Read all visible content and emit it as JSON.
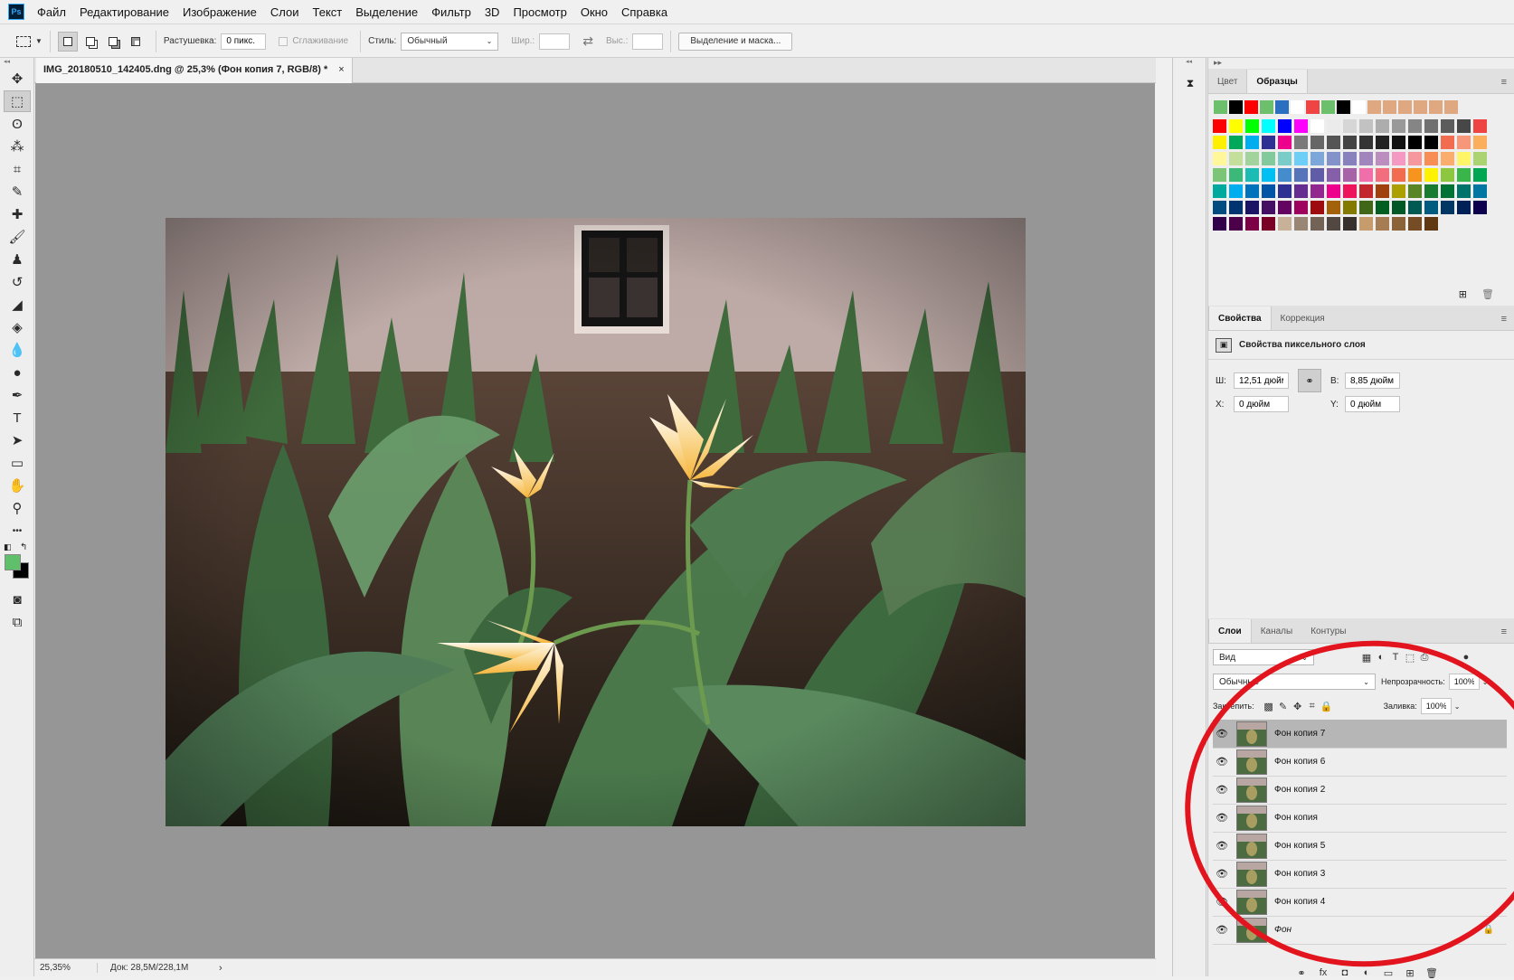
{
  "app": {
    "logo": "Ps",
    "menu": [
      "Файл",
      "Редактирование",
      "Изображение",
      "Слои",
      "Текст",
      "Выделение",
      "Фильтр",
      "3D",
      "Просмотр",
      "Окно",
      "Справка"
    ]
  },
  "options": {
    "feather_label": "Растушевка:",
    "feather_value": "0 пикс.",
    "antialias_label": "Сглаживание",
    "style_label": "Стиль:",
    "style_value": "Обычный",
    "width_label": "Шир.:",
    "height_label": "Выс.:",
    "select_mask_button": "Выделение и маска..."
  },
  "document": {
    "tab_title": "IMG_20180510_142405.dng @ 25,3% (Фон копия 7, RGB/8) *",
    "close": "×",
    "zoom": "25,35%",
    "doc_size": "Док: 28,5M/228,1M",
    "status_arrow": "›"
  },
  "toolbar": {
    "tools": [
      {
        "name": "move-tool",
        "glyph": "✥"
      },
      {
        "name": "marquee-tool",
        "glyph": "⬚",
        "active": true
      },
      {
        "name": "lasso-tool",
        "glyph": "ʘ"
      },
      {
        "name": "magic-wand-tool",
        "glyph": "⁂"
      },
      {
        "name": "crop-tool",
        "glyph": "⌗"
      },
      {
        "name": "eyedropper-tool",
        "glyph": "✎"
      },
      {
        "name": "healing-tool",
        "glyph": "✚"
      },
      {
        "name": "brush-tool",
        "glyph": "🖌"
      },
      {
        "name": "stamp-tool",
        "glyph": "♟"
      },
      {
        "name": "history-brush-tool",
        "glyph": "↺"
      },
      {
        "name": "eraser-tool",
        "glyph": "◢"
      },
      {
        "name": "paint-bucket-tool",
        "glyph": "◈"
      },
      {
        "name": "blur-tool",
        "glyph": "💧"
      },
      {
        "name": "dodge-tool",
        "glyph": "●"
      },
      {
        "name": "pen-tool",
        "glyph": "✒"
      },
      {
        "name": "type-tool",
        "glyph": "T"
      },
      {
        "name": "path-selection-tool",
        "glyph": "➤"
      },
      {
        "name": "rectangle-tool",
        "glyph": "▭"
      },
      {
        "name": "hand-tool",
        "glyph": "✋"
      },
      {
        "name": "zoom-tool",
        "glyph": "⚲"
      },
      {
        "name": "more-tools",
        "glyph": "•••"
      }
    ],
    "foreground_color": "#5fbf6b",
    "background_color": "#000000"
  },
  "swatches_panel": {
    "tabs": [
      "Цвет",
      "Образцы"
    ],
    "active_tab": 1,
    "recent": [
      "#6cc06c",
      "#000000",
      "#ff0000",
      "#6cc06c",
      "#2a6fc0",
      "#ffffff",
      "#ef4444",
      "#6cc06c",
      "#000000",
      "#ffffff",
      "#e0a880",
      "#e0a880",
      "#e0a880",
      "#e0a880",
      "#e0a880",
      "#e0a880"
    ],
    "grid": [
      "#ff0000",
      "#ffff00",
      "#00ff00",
      "#00ffff",
      "#0000ff",
      "#ff00ff",
      "#ffffff",
      "#ebebeb",
      "#d6d6d6",
      "#c2c2c2",
      "#adadad",
      "#999999",
      "#858585",
      "#707070",
      "#5c5c5c",
      "#474747",
      "#ef4444",
      "#ffef00",
      "#00a859",
      "#00aeef",
      "#2e3192",
      "#ec008c",
      "#7a7a7a",
      "#666666",
      "#555555",
      "#444444",
      "#333333",
      "#222222",
      "#111111",
      "#000000",
      "#000000",
      "#f26c4f",
      "#f7977a",
      "#fbaf5d",
      "#fff799",
      "#c4df9b",
      "#a3d39c",
      "#82ca9c",
      "#7accc8",
      "#6dcff6",
      "#7da7d8",
      "#8393ca",
      "#8781bd",
      "#a186be",
      "#bc8dbf",
      "#f49ac2",
      "#f5989d",
      "#f68e56",
      "#fbad6d",
      "#fff568",
      "#acd372",
      "#7cc576",
      "#3cb878",
      "#1cbbb4",
      "#00bff3",
      "#448ccb",
      "#5574b9",
      "#605ca8",
      "#855fa8",
      "#a763a8",
      "#f06eaa",
      "#f26d7d",
      "#f26c4f",
      "#f7941d",
      "#fff200",
      "#8dc73f",
      "#39b54a",
      "#00a651",
      "#00a99d",
      "#00aeef",
      "#0072bc",
      "#0054a6",
      "#2e3192",
      "#662d91",
      "#92278f",
      "#ec008c",
      "#ed145b",
      "#c1272d",
      "#a0410d",
      "#aba000",
      "#598527",
      "#197b30",
      "#007236",
      "#00746b",
      "#0076a3",
      "#004b80",
      "#003471",
      "#1b1464",
      "#440e62",
      "#630460",
      "#9e005d",
      "#9e0b0f",
      "#a36209",
      "#827b00",
      "#406618",
      "#005e20",
      "#005826",
      "#005952",
      "#005b7f",
      "#003663",
      "#002157",
      "#0d004c",
      "#32004b",
      "#4b0049",
      "#7b0046",
      "#7a0026",
      "#c7b299",
      "#998675",
      "#736357",
      "#534741",
      "#37302d",
      "#c69c6d",
      "#a67c52",
      "#8c6239",
      "#754c24",
      "#603913"
    ]
  },
  "properties_panel": {
    "tabs": [
      "Свойства",
      "Коррекция"
    ],
    "active_tab": 0,
    "title": "Свойства пиксельного слоя",
    "w_label": "Ш:",
    "w_value": "12,51 дюйм",
    "h_label": "В:",
    "h_value": "8,85 дюйм",
    "x_label": "X:",
    "x_value": "0 дюйм",
    "y_label": "Y:",
    "y_value": "0 дюйм"
  },
  "layers_panel": {
    "tabs": [
      "Слои",
      "Каналы",
      "Контуры"
    ],
    "active_tab": 0,
    "filter_placeholder": "Вид",
    "blend_mode": "Обычные",
    "opacity_label": "Непрозрачность:",
    "opacity_value": "100%",
    "lock_label": "Закрепить:",
    "fill_label": "Заливка:",
    "fill_value": "100%",
    "layers": [
      {
        "name": "Фон копия 7",
        "selected": true
      },
      {
        "name": "Фон копия 6"
      },
      {
        "name": "Фон копия 2"
      },
      {
        "name": "Фон копия"
      },
      {
        "name": "Фон копия 5"
      },
      {
        "name": "Фон копия 3"
      },
      {
        "name": "Фон копия 4"
      },
      {
        "name": "Фон",
        "italic": true,
        "locked": true
      }
    ]
  },
  "annotation": {
    "color": "#e2151f",
    "shape": "ellipse"
  }
}
